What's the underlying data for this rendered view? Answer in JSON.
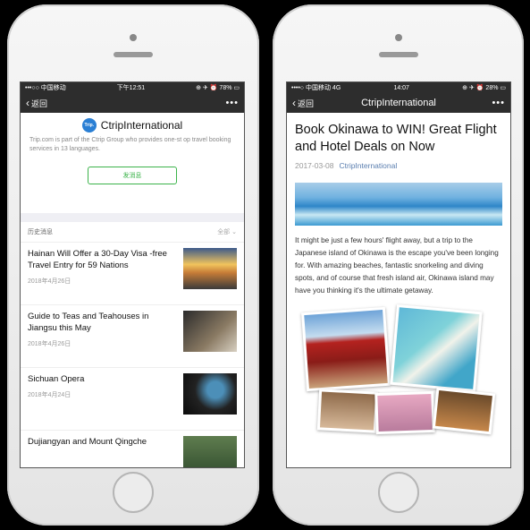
{
  "left": {
    "status": {
      "carrier": "•••○○ 中国移动 ",
      "time": "下午12:51",
      "right": "⊕ ✈ ⏰ 78% ▭"
    },
    "nav": {
      "back": "返回",
      "more": "•••"
    },
    "profile": {
      "logo_text": "Trip.",
      "name": "CtripInternational",
      "description": "Trip.com is part of the Ctrip Group who provides one-st op travel booking services in 13 languages.",
      "button": "发消息"
    },
    "history": {
      "label": "历史消息",
      "all": "全部 ⌄"
    },
    "articles": [
      {
        "title": "Hainan Will Offer a 30-Day Visa -free Travel Entry for 59 Nations",
        "date": "2018年4月26日"
      },
      {
        "title": "Guide to Teas and Teahouses in Jiangsu this May",
        "date": "2018年4月26日"
      },
      {
        "title": "Sichuan Opera",
        "date": "2018年4月24日"
      },
      {
        "title": "Dujiangyan and Mount Qingche",
        "date": ""
      }
    ]
  },
  "right": {
    "status": {
      "carrier": "••••○ 中国移动 4G",
      "time": "14:07",
      "right": "⊕ ✈ ⏰ 28% ▭"
    },
    "nav": {
      "back": "返回",
      "title": "CtripInternational",
      "more": "•••"
    },
    "article": {
      "title": "Book Okinawa to WIN! Great Flight and Hotel Deals on Now",
      "date": "2017-03-08",
      "account": "CtripInternational",
      "body": "It might be just a few hours' flight away, but a trip to the Japanese island of Okinawa is the escape you've been longing for. With amazing beaches, fantastic snorkeling and diving spots, and of course that fresh island air, Okinawa island may have you thinking it's the ultimate getaway."
    }
  }
}
